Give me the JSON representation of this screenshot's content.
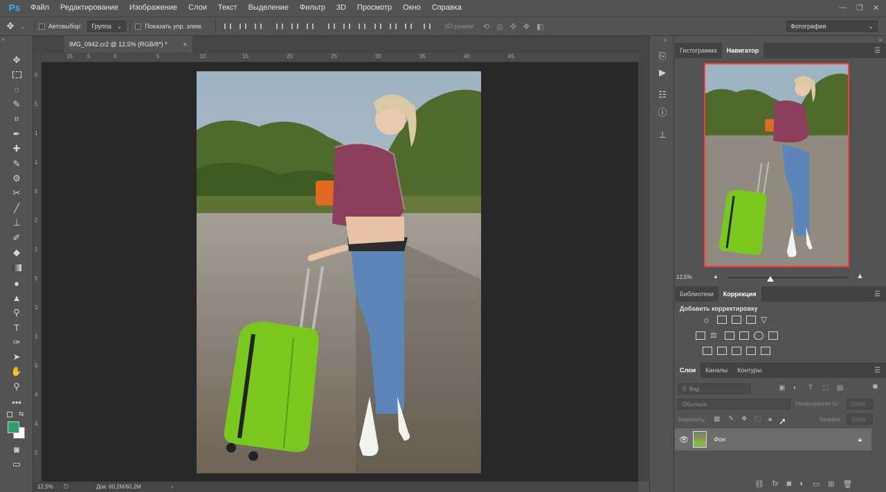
{
  "app": {
    "logo": "Ps"
  },
  "menu": [
    "Файл",
    "Редактирование",
    "Изображение",
    "Слои",
    "Текст",
    "Выделение",
    "Фильтр",
    "3D",
    "Просмотр",
    "Окно",
    "Справка"
  ],
  "window_controls": [
    "—",
    "❐",
    "✕"
  ],
  "options_bar": {
    "autoselect_label": "Автовыбор:",
    "autoselect_value": "Группа",
    "show_controls_label": "Показать упр. элем.",
    "mode3d_label": "3D-режим:",
    "workspace": "Фотография"
  },
  "document": {
    "tab_title": "IMG_0942.cr2 @ 12,5% (RGB/8*) *",
    "close": "×"
  },
  "ruler_h": [
    "15",
    "5",
    "0",
    "5",
    "10",
    "15",
    "20",
    "25",
    "30",
    "35",
    "40",
    "45"
  ],
  "ruler_v": [
    "0",
    "5",
    "1",
    "1",
    "5",
    "2",
    "2",
    "5",
    "3",
    "3",
    "5",
    "4",
    "4",
    "5"
  ],
  "status": {
    "zoom": "12,5%",
    "doc_info": "Док: 60,2M/60,2M",
    "arrow": "›"
  },
  "tools": [
    "move-tool",
    "marquee-tool",
    "lasso-tool",
    "quick-select-tool",
    "crop-tool",
    "eyedropper-tool",
    "healing-tool",
    "brush-tool",
    "stamp-tool",
    "history-brush-tool",
    "eraser-tool",
    "gradient-tool",
    "blur-tool",
    "dodge-tool",
    "pen-tool",
    "type-tool",
    "path-select-tool",
    "shape-tool",
    "hand-tool",
    "zoom-tool",
    "more-tools"
  ],
  "colors": {
    "foreground": "#2e9e6a",
    "background": "#ffffff",
    "accent_red": "#ff3a3a",
    "suitcase": "#7ac81f"
  },
  "panels": {
    "top_tabs": [
      "Гистограмма",
      "Навигатор"
    ],
    "navigator_zoom": "12,5%",
    "middle_tabs": [
      "Библиотеки",
      "Коррекция"
    ],
    "adjustments_title": "Добавить корректировку",
    "layer_tabs": [
      "Слои",
      "Каналы",
      "Контуры"
    ],
    "search_placeholder": "Вид",
    "blend_mode": "Обычные",
    "opacity_label": "Непрозрачность:",
    "opacity_value": "100%",
    "lock_label": "Закрепить:",
    "fill_label": "Заливка:",
    "fill_value": "100%",
    "layer_name": "Фон"
  }
}
